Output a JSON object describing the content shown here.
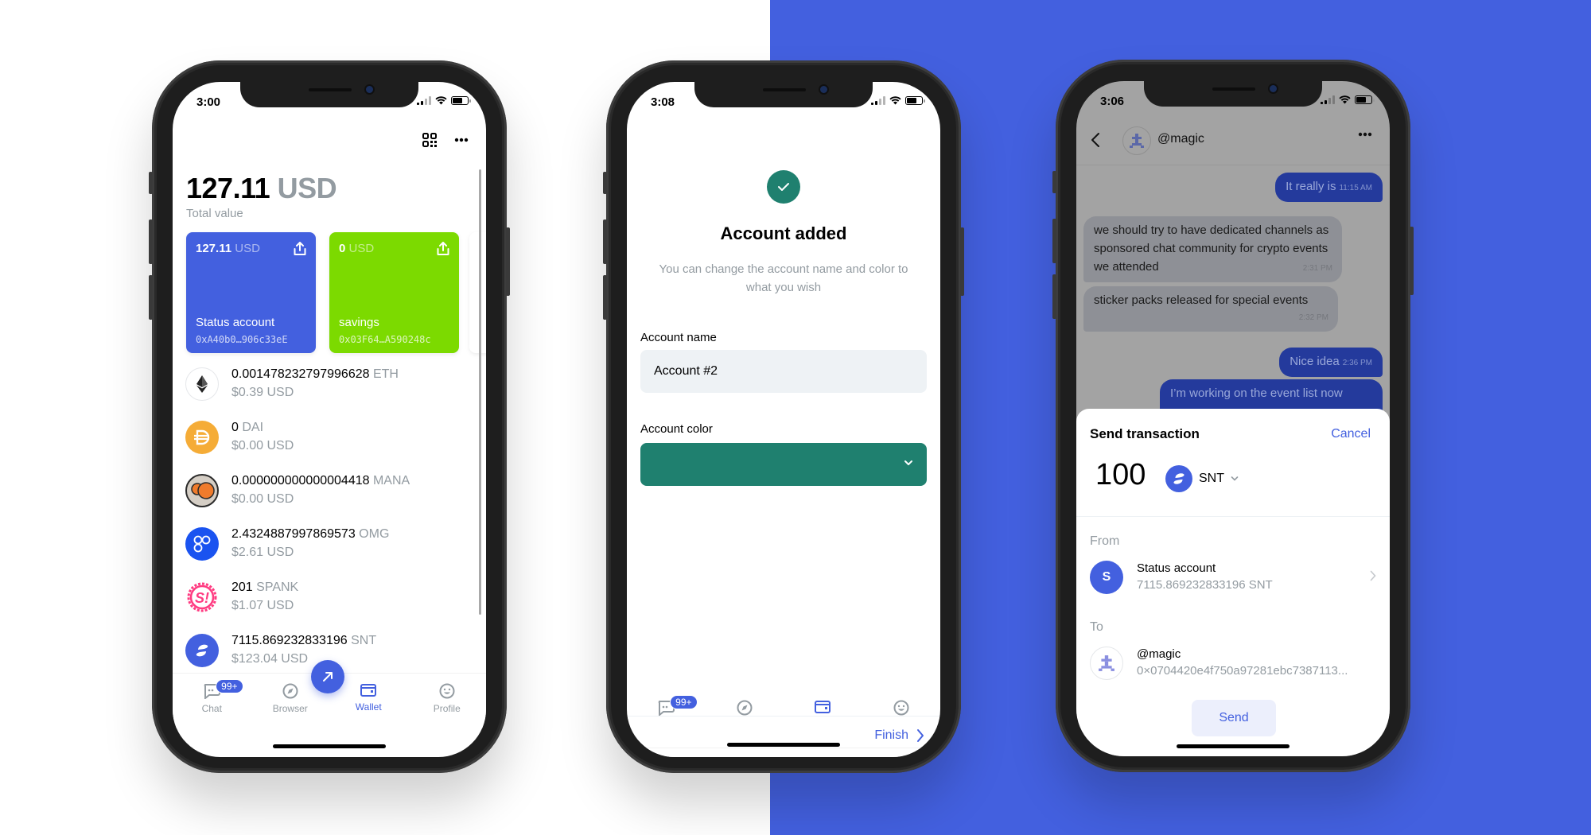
{
  "colors": {
    "accent": "#4360df",
    "success": "#1f806f",
    "savings": "#7cda00",
    "muted": "#939ba1"
  },
  "phones": [
    {
      "status": {
        "time": "3:00"
      },
      "wallet": {
        "total_amount": "127.11",
        "total_currency": "USD",
        "total_label": "Total value",
        "top_icons": [
          "qr-code-icon",
          "more-icon"
        ],
        "accounts": [
          {
            "amount": "127.11",
            "currency": "USD",
            "name": "Status account",
            "address": "0xA40b0…906c33eE",
            "color": "#4360df"
          },
          {
            "amount": "0",
            "currency": "USD",
            "name": "savings",
            "address": "0x03F64…A590248c",
            "color": "#7cda00"
          }
        ],
        "tokens": [
          {
            "amount": "0.001478232797996628",
            "symbol": "ETH",
            "usd": "$0.39 USD",
            "icon": "eth-icon"
          },
          {
            "amount": "0",
            "symbol": "DAI",
            "usd": "$0.00 USD",
            "icon": "dai-icon"
          },
          {
            "amount": "0.000000000000004418",
            "symbol": "MANA",
            "usd": "$0.00 USD",
            "icon": "mana-icon"
          },
          {
            "amount": "2.4324887997869573",
            "symbol": "OMG",
            "usd": "$2.61 USD",
            "icon": "omg-icon"
          },
          {
            "amount": "201",
            "symbol": "SPANK",
            "usd": "$1.07 USD",
            "icon": "spank-icon"
          },
          {
            "amount": "7115.869232833196",
            "symbol": "SNT",
            "usd": "$123.04 USD",
            "icon": "snt-icon"
          }
        ],
        "fab_icon": "send-arrow-icon"
      },
      "tabs": [
        {
          "label": "Chat",
          "icon": "chat-icon",
          "badge": "99+"
        },
        {
          "label": "Browser",
          "icon": "compass-icon"
        },
        {
          "label": "Wallet",
          "icon": "wallet-icon",
          "active": true
        },
        {
          "label": "Profile",
          "icon": "smiley-icon"
        }
      ]
    },
    {
      "status": {
        "time": "3:08"
      },
      "account_added": {
        "title": "Account added",
        "subtitle": "You can change the account name and color to what you wish",
        "name_label": "Account name",
        "name_value": "Account #2",
        "color_label": "Account color",
        "color_value": "#1f806f",
        "finish_label": "Finish"
      },
      "tabs": [
        {
          "icon": "chat-icon",
          "badge": "99+"
        },
        {
          "icon": "compass-icon"
        },
        {
          "icon": "wallet-icon",
          "active": true
        },
        {
          "icon": "smiley-icon"
        }
      ]
    },
    {
      "status": {
        "time": "3:06"
      },
      "chat": {
        "contact": "@magic",
        "messages": [
          {
            "direction": "out",
            "text": "It really is",
            "time": "11:15 AM"
          },
          {
            "direction": "in",
            "text": "we should try to have dedicated channels as sponsored chat community for crypto events we attended",
            "time": "2:31 PM"
          },
          {
            "direction": "in",
            "text": "sticker packs released for special events",
            "time": "2:32 PM"
          },
          {
            "direction": "out",
            "text": "Nice idea",
            "time": "2:36 PM"
          },
          {
            "direction": "out",
            "text": "I’m working on the event list now",
            "time": ""
          }
        ]
      },
      "send_sheet": {
        "title": "Send transaction",
        "cancel_label": "Cancel",
        "amount": "100",
        "asset": "SNT",
        "from_label": "From",
        "from_initial": "S",
        "from_name": "Status account",
        "from_balance": "7115.869232833196 SNT",
        "to_label": "To",
        "to_name": "@magic",
        "to_address": "0×0704420e4f750a97281ebc7387113...",
        "send_label": "Send"
      }
    }
  ]
}
